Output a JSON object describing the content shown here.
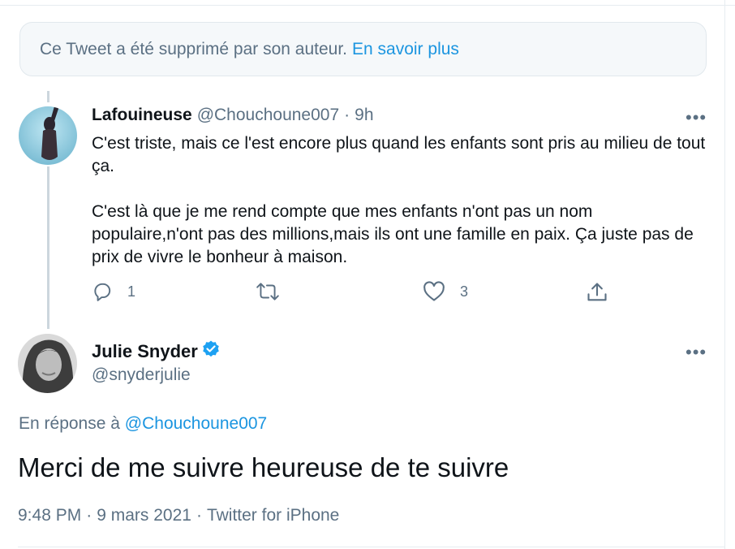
{
  "deleted_notice": {
    "message": "Ce Tweet a été supprimé par son auteur.",
    "learn_more": "En savoir plus"
  },
  "reply_tweet": {
    "name": "Lafouineuse",
    "handle": "@Chouchoune007",
    "separator": "·",
    "time": "9h",
    "more_icon": "more-horizontal-icon",
    "paragraphs": [
      "C'est triste, mais ce l'est encore plus quand les enfants sont pris au milieu de tout ça.",
      "C'est là que je me rend compte que mes enfants n'ont pas un nom populaire,n'ont pas des millions,mais ils ont une famille en paix. Ça juste pas de prix de vivre le bonheur à maison."
    ],
    "actions": {
      "reply": {
        "icon": "reply-icon",
        "count": "1"
      },
      "retweet": {
        "icon": "retweet-icon",
        "count": ""
      },
      "like": {
        "icon": "heart-icon",
        "count": "3"
      },
      "share": {
        "icon": "share-icon",
        "count": ""
      }
    }
  },
  "main_tweet": {
    "name": "Julie Snyder",
    "verified_icon": "verified-badge-icon",
    "handle": "@snyderjulie",
    "more_icon": "more-horizontal-icon",
    "reply_prefix": "En réponse à",
    "reply_mention": "@Chouchoune007",
    "text": "Merci de me suivre heureuse de te suivre",
    "time": "9:48 PM",
    "separator": "·",
    "date": "9 mars 2021",
    "source": "Twitter for iPhone"
  },
  "colors": {
    "accent": "#1b95e0",
    "secondary_text": "#5b7083",
    "primary_text": "#0f1419",
    "verified": "#1da1f2"
  }
}
